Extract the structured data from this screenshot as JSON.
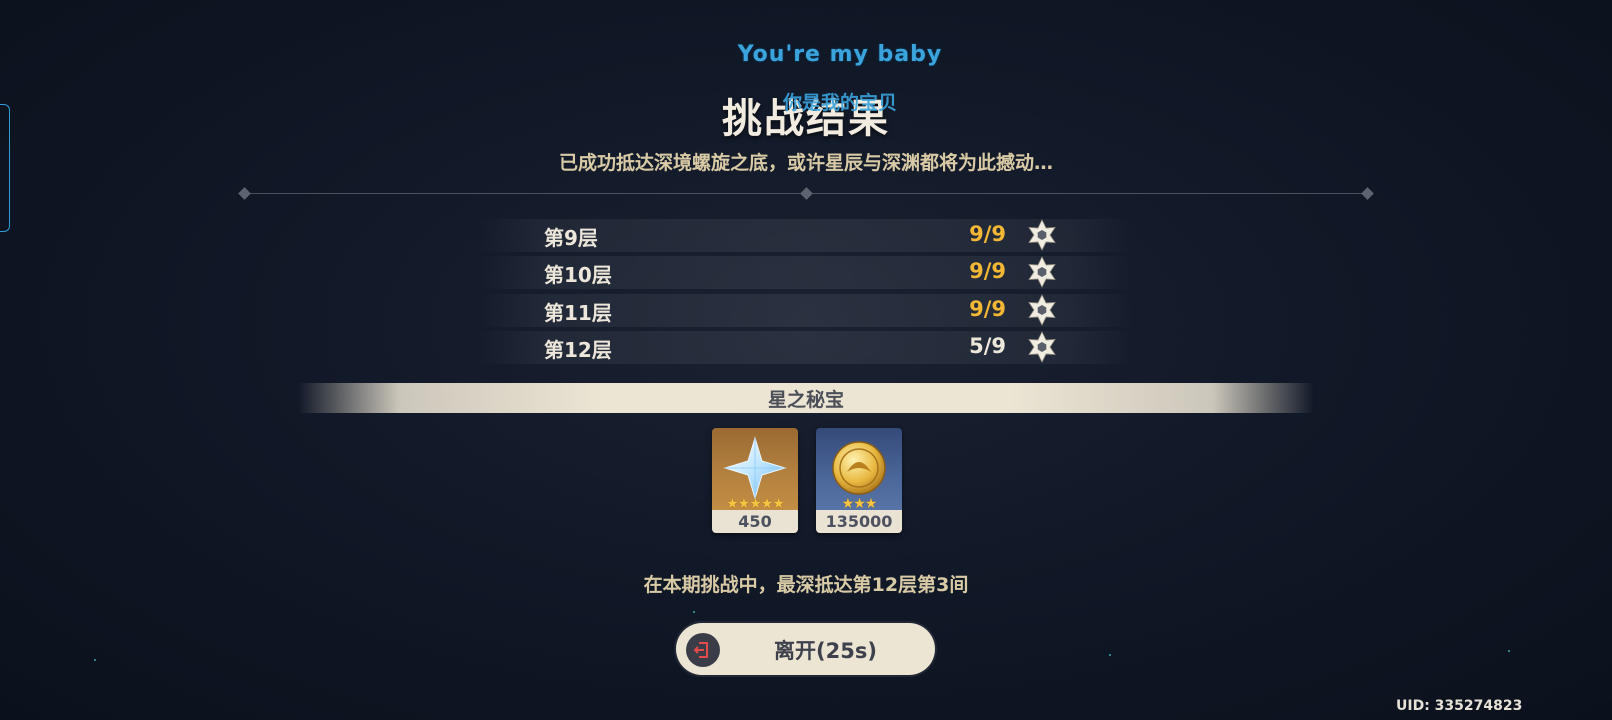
{
  "lyrics": {
    "english": "You're my baby",
    "chinese": "你是我的宝贝"
  },
  "title": "挑战结果",
  "subtitle": "已成功抵达深境螺旋之底，或许星辰与深渊都将为此撼动…",
  "floors": [
    {
      "name": "第9层",
      "score": "9/9",
      "stars_earned": 9,
      "stars_max": 9,
      "complete": true
    },
    {
      "name": "第10层",
      "score": "9/9",
      "stars_earned": 9,
      "stars_max": 9,
      "complete": true
    },
    {
      "name": "第11层",
      "score": "9/9",
      "stars_earned": 9,
      "stars_max": 9,
      "complete": true
    },
    {
      "name": "第12层",
      "score": "5/9",
      "stars_earned": 5,
      "stars_max": 9,
      "complete": false
    }
  ],
  "rewards": {
    "title": "星之秘宝",
    "items": [
      {
        "icon": "primogem-icon",
        "rarity": 5,
        "stars": "★★★★★",
        "count": "450"
      },
      {
        "icon": "mora-icon",
        "rarity": 3,
        "stars": "★★★",
        "count": "135000"
      }
    ]
  },
  "depth_text": "在本期挑战中，最深抵达第12层第3间",
  "leave_button": {
    "label": "离开(25s)",
    "icon": "exit-icon"
  },
  "uid": "UID: 335274823",
  "colors": {
    "score_complete": "#f2b735",
    "score_incomplete": "#ece7da",
    "lyric": "#3ba4dc",
    "band": "#ece5d4",
    "exit_icon": "#e34b4b"
  }
}
